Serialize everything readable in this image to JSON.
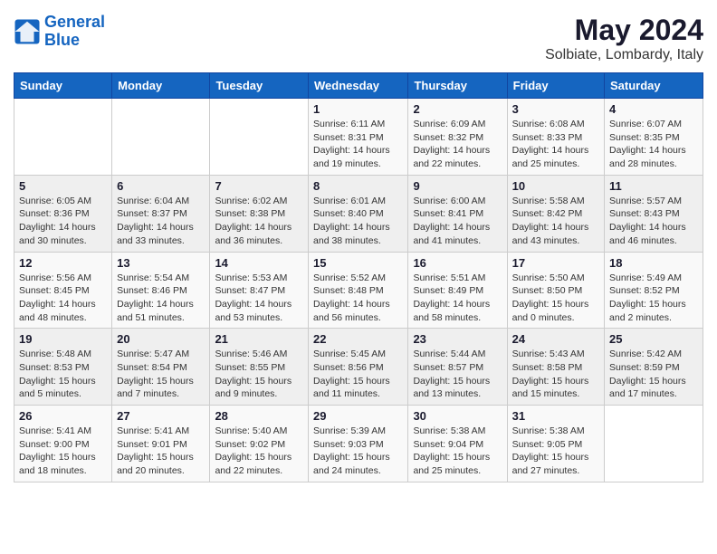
{
  "logo": {
    "line1": "General",
    "line2": "Blue"
  },
  "title": "May 2024",
  "subtitle": "Solbiate, Lombardy, Italy",
  "days_of_week": [
    "Sunday",
    "Monday",
    "Tuesday",
    "Wednesday",
    "Thursday",
    "Friday",
    "Saturday"
  ],
  "weeks": [
    [
      {
        "day": "",
        "info": ""
      },
      {
        "day": "",
        "info": ""
      },
      {
        "day": "",
        "info": ""
      },
      {
        "day": "1",
        "info": "Sunrise: 6:11 AM\nSunset: 8:31 PM\nDaylight: 14 hours\nand 19 minutes."
      },
      {
        "day": "2",
        "info": "Sunrise: 6:09 AM\nSunset: 8:32 PM\nDaylight: 14 hours\nand 22 minutes."
      },
      {
        "day": "3",
        "info": "Sunrise: 6:08 AM\nSunset: 8:33 PM\nDaylight: 14 hours\nand 25 minutes."
      },
      {
        "day": "4",
        "info": "Sunrise: 6:07 AM\nSunset: 8:35 PM\nDaylight: 14 hours\nand 28 minutes."
      }
    ],
    [
      {
        "day": "5",
        "info": "Sunrise: 6:05 AM\nSunset: 8:36 PM\nDaylight: 14 hours\nand 30 minutes."
      },
      {
        "day": "6",
        "info": "Sunrise: 6:04 AM\nSunset: 8:37 PM\nDaylight: 14 hours\nand 33 minutes."
      },
      {
        "day": "7",
        "info": "Sunrise: 6:02 AM\nSunset: 8:38 PM\nDaylight: 14 hours\nand 36 minutes."
      },
      {
        "day": "8",
        "info": "Sunrise: 6:01 AM\nSunset: 8:40 PM\nDaylight: 14 hours\nand 38 minutes."
      },
      {
        "day": "9",
        "info": "Sunrise: 6:00 AM\nSunset: 8:41 PM\nDaylight: 14 hours\nand 41 minutes."
      },
      {
        "day": "10",
        "info": "Sunrise: 5:58 AM\nSunset: 8:42 PM\nDaylight: 14 hours\nand 43 minutes."
      },
      {
        "day": "11",
        "info": "Sunrise: 5:57 AM\nSunset: 8:43 PM\nDaylight: 14 hours\nand 46 minutes."
      }
    ],
    [
      {
        "day": "12",
        "info": "Sunrise: 5:56 AM\nSunset: 8:45 PM\nDaylight: 14 hours\nand 48 minutes."
      },
      {
        "day": "13",
        "info": "Sunrise: 5:54 AM\nSunset: 8:46 PM\nDaylight: 14 hours\nand 51 minutes."
      },
      {
        "day": "14",
        "info": "Sunrise: 5:53 AM\nSunset: 8:47 PM\nDaylight: 14 hours\nand 53 minutes."
      },
      {
        "day": "15",
        "info": "Sunrise: 5:52 AM\nSunset: 8:48 PM\nDaylight: 14 hours\nand 56 minutes."
      },
      {
        "day": "16",
        "info": "Sunrise: 5:51 AM\nSunset: 8:49 PM\nDaylight: 14 hours\nand 58 minutes."
      },
      {
        "day": "17",
        "info": "Sunrise: 5:50 AM\nSunset: 8:50 PM\nDaylight: 15 hours\nand 0 minutes."
      },
      {
        "day": "18",
        "info": "Sunrise: 5:49 AM\nSunset: 8:52 PM\nDaylight: 15 hours\nand 2 minutes."
      }
    ],
    [
      {
        "day": "19",
        "info": "Sunrise: 5:48 AM\nSunset: 8:53 PM\nDaylight: 15 hours\nand 5 minutes."
      },
      {
        "day": "20",
        "info": "Sunrise: 5:47 AM\nSunset: 8:54 PM\nDaylight: 15 hours\nand 7 minutes."
      },
      {
        "day": "21",
        "info": "Sunrise: 5:46 AM\nSunset: 8:55 PM\nDaylight: 15 hours\nand 9 minutes."
      },
      {
        "day": "22",
        "info": "Sunrise: 5:45 AM\nSunset: 8:56 PM\nDaylight: 15 hours\nand 11 minutes."
      },
      {
        "day": "23",
        "info": "Sunrise: 5:44 AM\nSunset: 8:57 PM\nDaylight: 15 hours\nand 13 minutes."
      },
      {
        "day": "24",
        "info": "Sunrise: 5:43 AM\nSunset: 8:58 PM\nDaylight: 15 hours\nand 15 minutes."
      },
      {
        "day": "25",
        "info": "Sunrise: 5:42 AM\nSunset: 8:59 PM\nDaylight: 15 hours\nand 17 minutes."
      }
    ],
    [
      {
        "day": "26",
        "info": "Sunrise: 5:41 AM\nSunset: 9:00 PM\nDaylight: 15 hours\nand 18 minutes."
      },
      {
        "day": "27",
        "info": "Sunrise: 5:41 AM\nSunset: 9:01 PM\nDaylight: 15 hours\nand 20 minutes."
      },
      {
        "day": "28",
        "info": "Sunrise: 5:40 AM\nSunset: 9:02 PM\nDaylight: 15 hours\nand 22 minutes."
      },
      {
        "day": "29",
        "info": "Sunrise: 5:39 AM\nSunset: 9:03 PM\nDaylight: 15 hours\nand 24 minutes."
      },
      {
        "day": "30",
        "info": "Sunrise: 5:38 AM\nSunset: 9:04 PM\nDaylight: 15 hours\nand 25 minutes."
      },
      {
        "day": "31",
        "info": "Sunrise: 5:38 AM\nSunset: 9:05 PM\nDaylight: 15 hours\nand 27 minutes."
      },
      {
        "day": "",
        "info": ""
      }
    ]
  ]
}
